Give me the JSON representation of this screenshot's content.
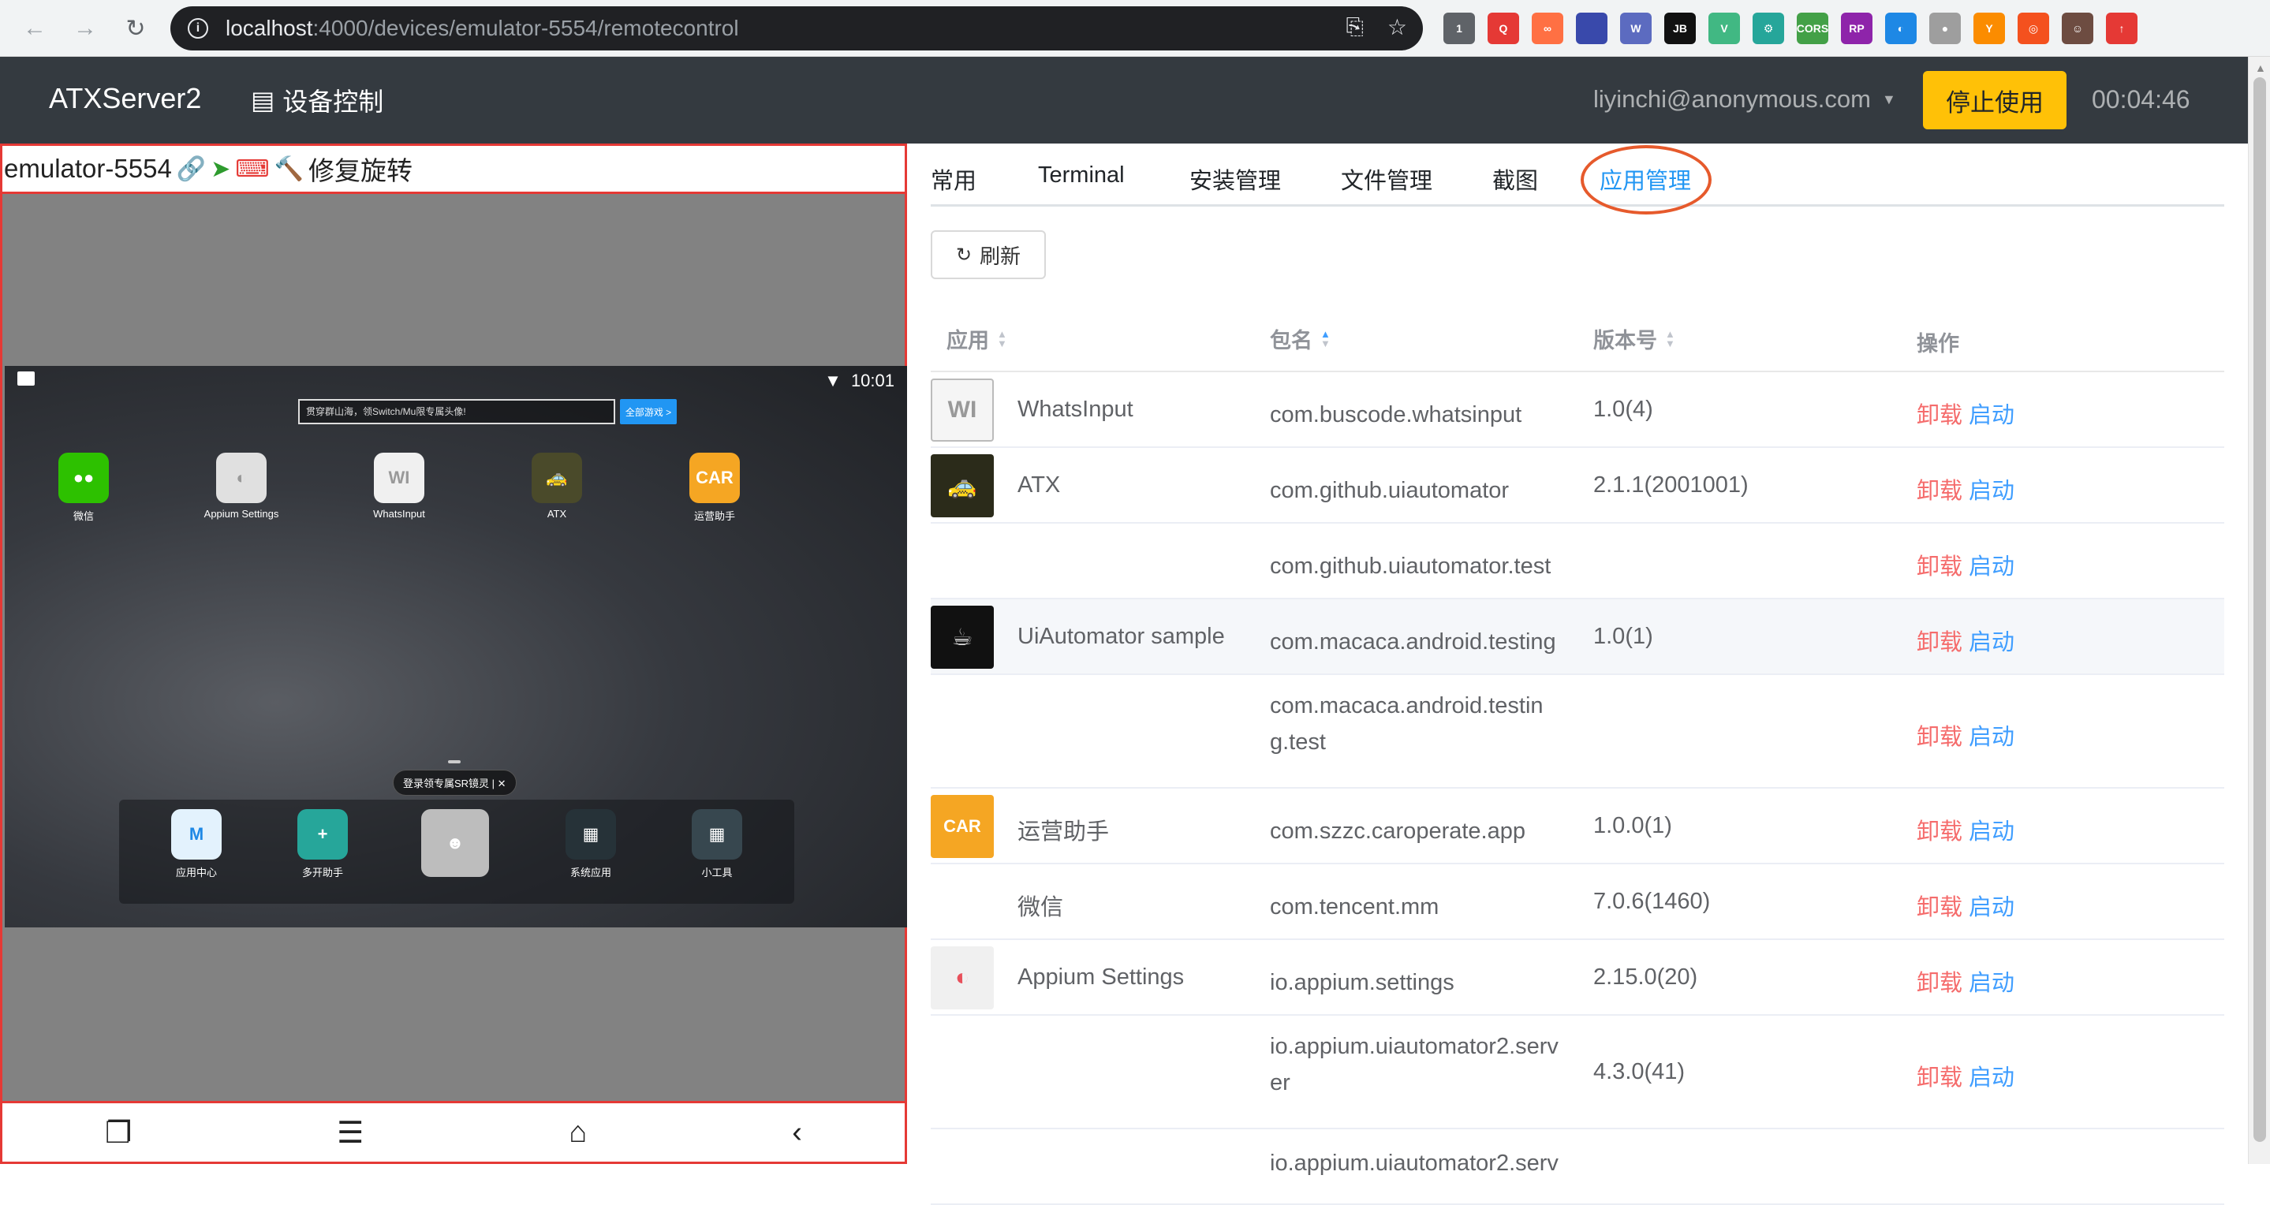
{
  "browser": {
    "url_host": "localhost",
    "url_path": ":4000/devices/emulator-5554/remotecontrol",
    "extensions": [
      {
        "name": "ext-1",
        "text": "1",
        "color": "#5f6368"
      },
      {
        "name": "ext-2",
        "text": "Q",
        "color": "#e53935"
      },
      {
        "name": "ext-3",
        "text": "∞",
        "color": "#ff7043"
      },
      {
        "name": "ext-4",
        "text": "",
        "color": "#3949ab"
      },
      {
        "name": "ext-5",
        "text": "W",
        "color": "#5c6bc0"
      },
      {
        "name": "ext-6",
        "text": "JB",
        "color": "#111111"
      },
      {
        "name": "ext-7",
        "text": "V",
        "color": "#41b883"
      },
      {
        "name": "ext-8",
        "text": "⚙",
        "color": "#26a69a"
      },
      {
        "name": "ext-9",
        "text": "CORS",
        "color": "#43a047"
      },
      {
        "name": "ext-10",
        "text": "RP",
        "color": "#8e24aa"
      },
      {
        "name": "ext-11",
        "text": "◐",
        "color": "#1e88e5"
      },
      {
        "name": "ext-12",
        "text": "●",
        "color": "#9e9e9e"
      },
      {
        "name": "ext-13",
        "text": "Y",
        "color": "#fb8c00"
      },
      {
        "name": "ext-14",
        "text": "◎",
        "color": "#f4511e"
      },
      {
        "name": "ext-15",
        "text": "☺",
        "color": "#6d4c41"
      },
      {
        "name": "ext-16",
        "text": "↑",
        "color": "#e53935"
      }
    ]
  },
  "navbar": {
    "brand": "ATXServer2",
    "device_control": "设备控制",
    "user": "liyinchi@anonymous.com",
    "stop_label": "停止使用",
    "timer": "00:04:46"
  },
  "device": {
    "serial": "emulator-5554",
    "fix_rotation": "修复旋转",
    "time": "10:01",
    "search_placeholder": "贯穿群山海，领Switch/Mu限专属头像!",
    "search_button": "全部游戏 >",
    "home_apps": [
      {
        "label": "微信",
        "icon": "wechat-icon",
        "color": "#2dc100",
        "glyph": "●●"
      },
      {
        "label": "Appium Settings",
        "icon": "appium-icon",
        "color": "#e0e0e0",
        "glyph": "◐"
      },
      {
        "label": "WhatsInput",
        "icon": "whatsinput-icon",
        "color": "#f0f0f0",
        "glyph": "WI"
      },
      {
        "label": "ATX",
        "icon": "taxi-icon",
        "color": "#4a4a2a",
        "glyph": "🚕"
      },
      {
        "label": "运营助手",
        "icon": "car-icon",
        "color": "#f5a623",
        "glyph": "CAR"
      }
    ],
    "dock_banner": "登录领专属SR镜灵 | ✕",
    "dock_apps": [
      {
        "label": "应用中心",
        "icon": "app-center-icon",
        "color": "#e3f2fd",
        "glyph": "M"
      },
      {
        "label": "多开助手",
        "icon": "multi-open-icon",
        "color": "#26a69a",
        "glyph": "+"
      },
      {
        "label": "",
        "icon": "game-avatar-icon",
        "color": "#bdbdbd",
        "glyph": "☻"
      },
      {
        "label": "系统应用",
        "icon": "system-apps-icon",
        "color": "#263238",
        "glyph": "▦"
      },
      {
        "label": "小工具",
        "icon": "tools-icon",
        "color": "#37474f",
        "glyph": "▦"
      }
    ]
  },
  "tabs": [
    {
      "label": "常用"
    },
    {
      "label": "Terminal"
    },
    {
      "label": "安装管理"
    },
    {
      "label": "文件管理"
    },
    {
      "label": "截图"
    },
    {
      "label": "应用管理"
    }
  ],
  "refresh_label": "刷新",
  "table": {
    "headers": {
      "app": "应用",
      "package": "包名",
      "version": "版本号",
      "ops": "操作"
    },
    "uninstall": "卸载",
    "launch": "启动",
    "rows": [
      {
        "app": "WhatsInput",
        "package": "com.buscode.whatsinput",
        "package2": "",
        "version": "1.0(4)",
        "thumb": "whatsinput-thumb-icon",
        "thumb_text": "WI",
        "thumb_color": "#f5f5f5",
        "thumb_fg": "#999999"
      },
      {
        "app": "ATX",
        "package": "com.github.uiautomator",
        "package2": "",
        "version": "2.1.1(2001001)",
        "thumb": "taxi-thumb-icon",
        "thumb_text": "🚕",
        "thumb_color": "#2b2b1a",
        "thumb_fg": "#f9d71c"
      },
      {
        "app": "",
        "package": "com.github.uiautomator.test",
        "package2": "",
        "version": "",
        "thumb": "",
        "thumb_text": "",
        "thumb_color": "",
        "thumb_fg": ""
      },
      {
        "app": "UiAutomator sample",
        "package": "com.macaca.android.testing",
        "package2": "",
        "version": "1.0(1)",
        "thumb": "macaca-thumb-icon",
        "thumb_text": "☕",
        "thumb_color": "#111111",
        "thumb_fg": "#dddddd"
      },
      {
        "app": "",
        "package": "com.macaca.android.testin",
        "package2": "g.test",
        "version": "",
        "thumb": "",
        "thumb_text": "",
        "thumb_color": "",
        "thumb_fg": ""
      },
      {
        "app": "运营助手",
        "package": "com.szzc.caroperate.app",
        "package2": "",
        "version": "1.0.0(1)",
        "thumb": "car-thumb-icon",
        "thumb_text": "CAR",
        "thumb_color": "#f5a623",
        "thumb_fg": "#ffffff"
      },
      {
        "app": "微信",
        "package": "com.tencent.mm",
        "package2": "",
        "version": "7.0.6(1460)",
        "thumb": "",
        "thumb_text": "",
        "thumb_color": "",
        "thumb_fg": ""
      },
      {
        "app": "Appium Settings",
        "package": "io.appium.settings",
        "package2": "",
        "version": "2.15.0(20)",
        "thumb": "appium-thumb-icon",
        "thumb_text": "◐",
        "thumb_color": "#f0f0f0",
        "thumb_fg": "#e8505b"
      },
      {
        "app": "",
        "package": "io.appium.uiautomator2.serv",
        "package2": "er",
        "version": "4.3.0(41)",
        "thumb": "",
        "thumb_text": "",
        "thumb_color": "",
        "thumb_fg": ""
      },
      {
        "app": "",
        "package": "io.appium.uiautomator2.serv",
        "package2": "",
        "version": "",
        "thumb": "",
        "thumb_text": "",
        "thumb_color": "",
        "thumb_fg": ""
      }
    ]
  }
}
